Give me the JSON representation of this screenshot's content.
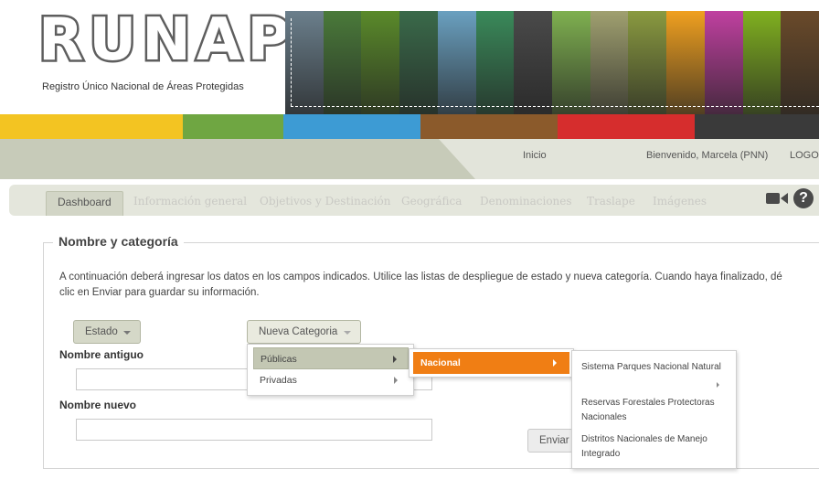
{
  "header": {
    "logo_text": "RUNAP",
    "logo_subtitle": "Registro Único Nacional de Áreas Protegidas",
    "banner_colors": [
      "#6b7f8c",
      "#4a7a3a",
      "#5a8a2a",
      "#3a6a4a",
      "#6aa0c0",
      "#3a8a5a",
      "#4a4a4a",
      "#7fb050",
      "#a0a070",
      "#8a9a40",
      "#f0a020",
      "#c040a0",
      "#80b020",
      "#6a4a2a"
    ],
    "color_bar": [
      "#f3c422",
      "#f3c422",
      "#6fa642",
      "#3d9bd4",
      "#8b5a2b",
      "#d62d2d",
      "#3a3a3a"
    ]
  },
  "nav": {
    "inicio": "Inicio",
    "welcome": "Bienvenido, Marcela (PNN)",
    "logout": "LOGOU"
  },
  "tabs": [
    {
      "label": "Dashboard"
    },
    {
      "label": "Información general"
    },
    {
      "label": "Objetivos y Destinación"
    },
    {
      "label": "Geográfica"
    },
    {
      "label": "Denominaciones"
    },
    {
      "label": "Traslape"
    },
    {
      "label": "Imágenes"
    }
  ],
  "icons": {
    "video": "video-camera-icon",
    "help": "help-icon",
    "help_glyph": "?"
  },
  "form": {
    "legend": "Nombre y categoría",
    "instructions": "A continuación deberá ingresar los datos en los campos indicados. Utilice las listas de despliegue de estado y nueva categoría. Cuando haya finalizado, dé clic en Enviar para guardar su información.",
    "estado_button": "Estado",
    "nueva_categoria_button": "Nueva Categoria",
    "nombre_antiguo_label": "Nombre antiguo",
    "nombre_antiguo_value": "",
    "nombre_nuevo_label": "Nombre nuevo",
    "nombre_nuevo_value": "",
    "enviar_button": "Enviar"
  },
  "menus": {
    "level1": [
      {
        "label": "Públicas"
      },
      {
        "label": "Privadas"
      }
    ],
    "level2": [
      {
        "label": "Nacional"
      }
    ],
    "level3": [
      {
        "label": "Sistema Parques Nacional Natural"
      },
      {
        "label": "Reservas Forestales Protectoras Nacionales"
      },
      {
        "label": "Distritos Nacionales de Manejo Integrado"
      }
    ]
  },
  "accent_color": "#f07e14"
}
